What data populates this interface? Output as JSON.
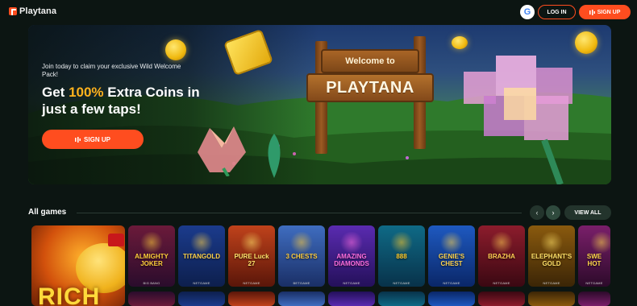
{
  "header": {
    "logo_text": "Playtana",
    "google_icon_label": "G",
    "login_label": "LOG IN",
    "signup_label": "SIGN UP"
  },
  "hero": {
    "kicker": "Join today to claim your exclusive Wild Welcome Pack!",
    "title_prefix": "Get ",
    "title_accent": "100%",
    "title_suffix": " Extra Coins in just a few taps!",
    "cta_label": "SIGN UP",
    "sign_top": "Welcome to",
    "sign_main": "PLAYTANA"
  },
  "games": {
    "section_title": "All games",
    "prev_icon": "‹",
    "next_icon": "›",
    "view_all_label": "VIEW ALL",
    "featured": {
      "name": "RICH"
    },
    "tiles": [
      {
        "name": "ALMIGHTY JOKER",
        "provider": "BIG BANG",
        "colors": [
          "#6b1a3a",
          "#2a0c2c"
        ],
        "accent": "#ffcf3a"
      },
      {
        "name": "TITANGOLD",
        "provider": "NETGAME",
        "colors": [
          "#1b3b8c",
          "#0d1f4d"
        ],
        "accent": "#ffd24a"
      },
      {
        "name": "PURE Luck 27",
        "provider": "NETGAME",
        "colors": [
          "#c0421b",
          "#5a1609"
        ],
        "accent": "#ffe36a"
      },
      {
        "name": "3 CHESTS",
        "provider": "BETGAME",
        "colors": [
          "#3f6dc0",
          "#1a2f66"
        ],
        "accent": "#ffcd3e"
      },
      {
        "name": "AMAZING DIAMONDS",
        "provider": "NETGAME",
        "colors": [
          "#5a2bb0",
          "#24105a"
        ],
        "accent": "#ff6ee0"
      },
      {
        "name": "888",
        "provider": "NETGAME",
        "colors": [
          "#0f6a86",
          "#08324a"
        ],
        "accent": "#ffcb2b"
      },
      {
        "name": "GENIE'S CHEST",
        "provider": "NETGAME",
        "colors": [
          "#1e59c0",
          "#0a2768"
        ],
        "accent": "#ffd54f"
      },
      {
        "name": "BRAZHA",
        "provider": "NETGAME",
        "colors": [
          "#8c1c2c",
          "#3a0812"
        ],
        "accent": "#ffce52"
      },
      {
        "name": "ELEPHANT'S GOLD",
        "provider": "NETGAME",
        "colors": [
          "#8a5a0e",
          "#3b2506"
        ],
        "accent": "#ffe067"
      },
      {
        "name": "SWE HOT",
        "provider": "NETGAME",
        "colors": [
          "#7a1f6a",
          "#2c0a2a"
        ],
        "accent": "#ffd84a"
      }
    ]
  }
}
